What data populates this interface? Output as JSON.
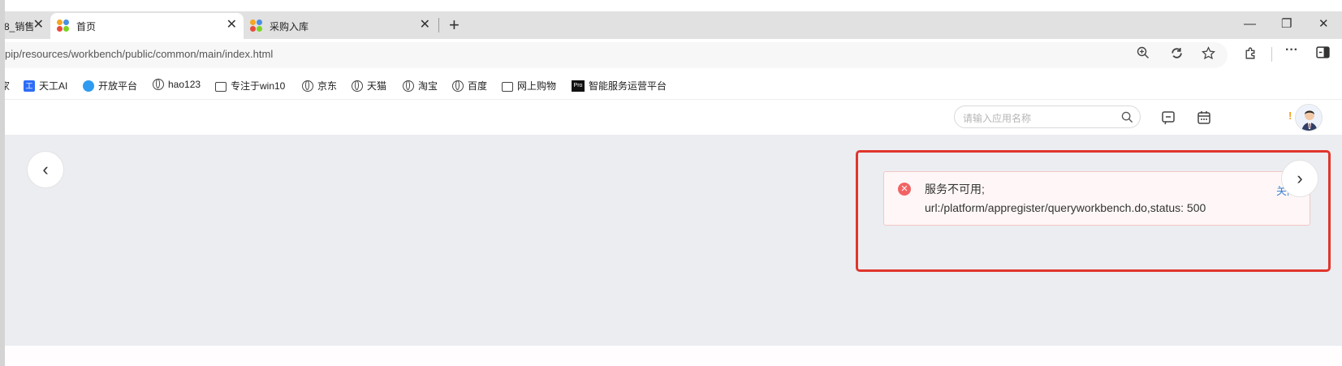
{
  "browser": {
    "tabs": [
      {
        "title": "8_销售",
        "active": false
      },
      {
        "title": "首页",
        "active": true
      },
      {
        "title": "采购入库",
        "active": false
      }
    ],
    "new_tab_glyph": "+",
    "window_controls": {
      "minimize": "—",
      "restore": "❐",
      "close": "✕"
    },
    "url": "pip/resources/workbench/public/common/main/index.html",
    "address_icons": [
      "zoom-icon",
      "refresh-sync-icon",
      "favorite-star-icon",
      "extensions-icon",
      "more-icon",
      "sidebar-icon"
    ],
    "more_glyph": "···"
  },
  "bookmarks": [
    {
      "label": "家",
      "icon": "partial"
    },
    {
      "label": "天工AI",
      "icon": "tiangong-icon"
    },
    {
      "label": "开放平台",
      "icon": "open-platform-icon"
    },
    {
      "label": "hao123",
      "icon": "globe-icon"
    },
    {
      "label": "专注于win10",
      "icon": "folder-icon"
    },
    {
      "label": "京东",
      "icon": "globe-icon"
    },
    {
      "label": "天猫",
      "icon": "globe-icon"
    },
    {
      "label": "淘宝",
      "icon": "globe-icon"
    },
    {
      "label": "百度",
      "icon": "globe-icon"
    },
    {
      "label": "网上购物",
      "icon": "folder-icon"
    },
    {
      "label": "智能服务运营平台",
      "icon": "pro-icon",
      "badge": "Pro"
    }
  ],
  "header": {
    "search_placeholder": "请输入应用名称",
    "alert_mark": "!"
  },
  "carousel": {
    "prev": "‹",
    "next": "›"
  },
  "toast": {
    "type": "error",
    "message": "服务不可用; url:/platform/appregister/queryworkbench.do,status: 500",
    "close_label": "关闭"
  },
  "colors": {
    "accent_error": "#f26464",
    "highlight_border": "#e0362d",
    "link_blue": "#3d85d8",
    "page_bg": "#ebedf1"
  }
}
